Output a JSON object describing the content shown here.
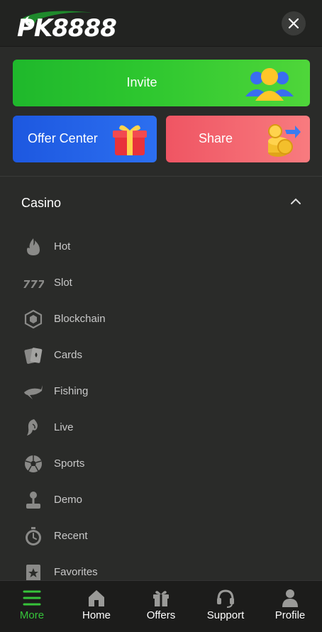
{
  "header": {
    "logo_text": "PK8888"
  },
  "promos": {
    "invite": {
      "label": "Invite"
    },
    "offer": {
      "label": "Offer Center"
    },
    "share": {
      "label": "Share"
    }
  },
  "casino": {
    "title": "Casino",
    "items": [
      {
        "label": "Hot",
        "icon": "flame-icon"
      },
      {
        "label": "Slot",
        "icon": "slot-777-icon"
      },
      {
        "label": "Blockchain",
        "icon": "blockchain-cube-icon"
      },
      {
        "label": "Cards",
        "icon": "cards-icon"
      },
      {
        "label": "Fishing",
        "icon": "shark-icon"
      },
      {
        "label": "Live",
        "icon": "live-dealer-icon"
      },
      {
        "label": "Sports",
        "icon": "soccer-ball-icon"
      },
      {
        "label": "Demo",
        "icon": "joystick-icon"
      },
      {
        "label": "Recent",
        "icon": "stopwatch-icon"
      },
      {
        "label": "Favorites",
        "icon": "favorites-star-icon"
      }
    ]
  },
  "bottom_nav": [
    {
      "label": "More",
      "icon": "menu-icon",
      "active": true
    },
    {
      "label": "Home",
      "icon": "home-icon",
      "active": false
    },
    {
      "label": "Offers",
      "icon": "gift-icon",
      "active": false
    },
    {
      "label": "Support",
      "icon": "headset-icon",
      "active": false
    },
    {
      "label": "Profile",
      "icon": "user-icon",
      "active": false
    }
  ],
  "colors": {
    "accent": "#36c43a",
    "background": "#2a2b29",
    "header": "#222321",
    "nav": "#1c1c1b"
  }
}
